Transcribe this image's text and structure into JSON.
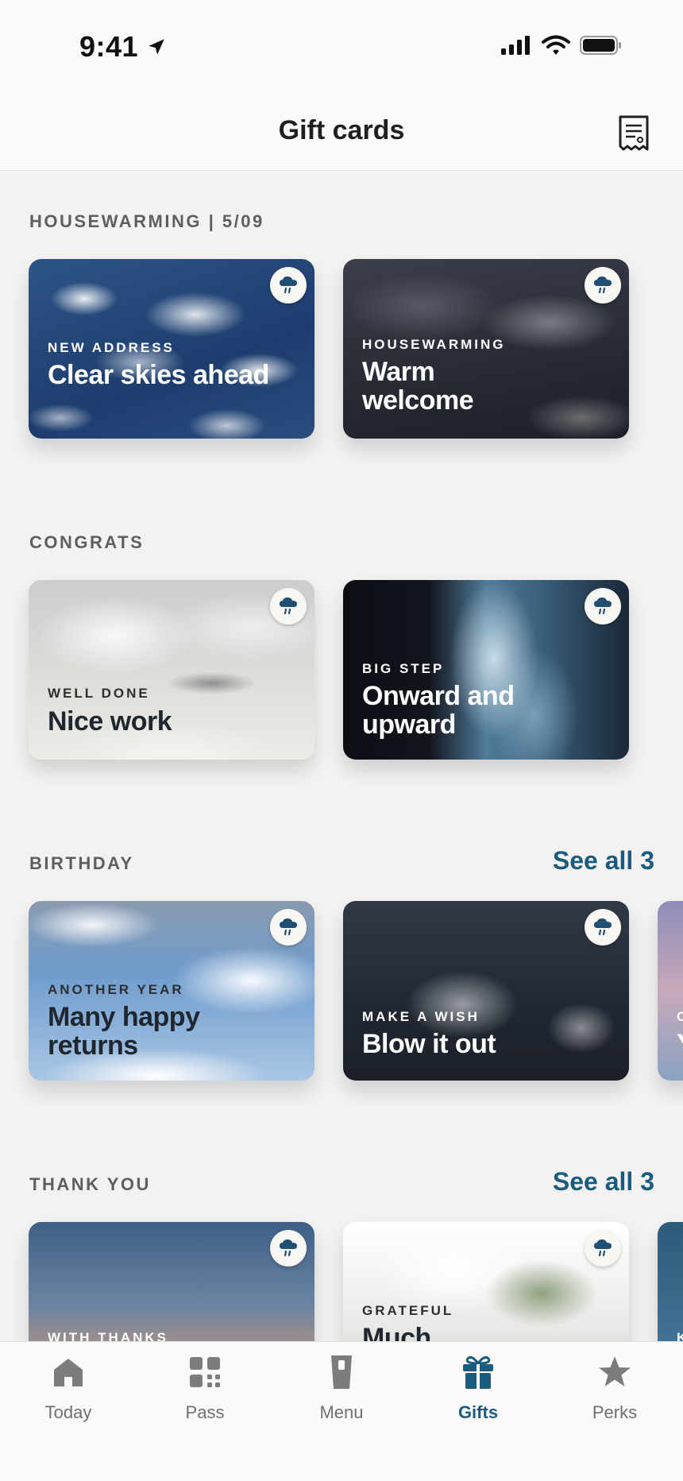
{
  "status_bar": {
    "time": "9:41"
  },
  "header": {
    "title": "Gift cards",
    "receipt_icon": "receipt-icon"
  },
  "colors": {
    "accent": "#1b5b80",
    "background": "#f3f2f0",
    "badge_icon": "#1f4f73"
  },
  "sections": [
    {
      "title": "HOUSEWARMING | 5/09",
      "see_all": "",
      "cards": [
        {
          "eyebrow": "NEW ADDRESS",
          "headline": "Clear skies ahead"
        },
        {
          "eyebrow": "HOUSEWARMING",
          "headline": "Warm welcome"
        }
      ]
    },
    {
      "title": "CONGRATS",
      "see_all": "",
      "cards": [
        {
          "eyebrow": "WELL DONE",
          "headline": "Nice work"
        },
        {
          "eyebrow": "BIG STEP",
          "headline": "Onward and upward"
        }
      ]
    },
    {
      "title": "BIRTHDAY",
      "see_all": "See all 3",
      "cards": [
        {
          "eyebrow": "ANOTHER YEAR",
          "headline": "Many happy returns"
        },
        {
          "eyebrow": "MAKE A WISH",
          "headline": "Blow it out"
        },
        {
          "eyebrow": "C",
          "headline": "Y"
        }
      ]
    },
    {
      "title": "THANK YOU",
      "see_all": "See all 3",
      "cards": [
        {
          "eyebrow": "WITH THANKS",
          "headline": ""
        },
        {
          "eyebrow": "GRATEFUL",
          "headline": "Much"
        },
        {
          "eyebrow": "K",
          "headline": ""
        }
      ]
    }
  ],
  "tabs": [
    {
      "label": "Today",
      "icon": "home-icon"
    },
    {
      "label": "Pass",
      "icon": "grid-icon"
    },
    {
      "label": "Menu",
      "icon": "cup-icon"
    },
    {
      "label": "Gifts",
      "icon": "gift-icon",
      "active": true
    },
    {
      "label": "Perks",
      "icon": "star-icon"
    }
  ]
}
